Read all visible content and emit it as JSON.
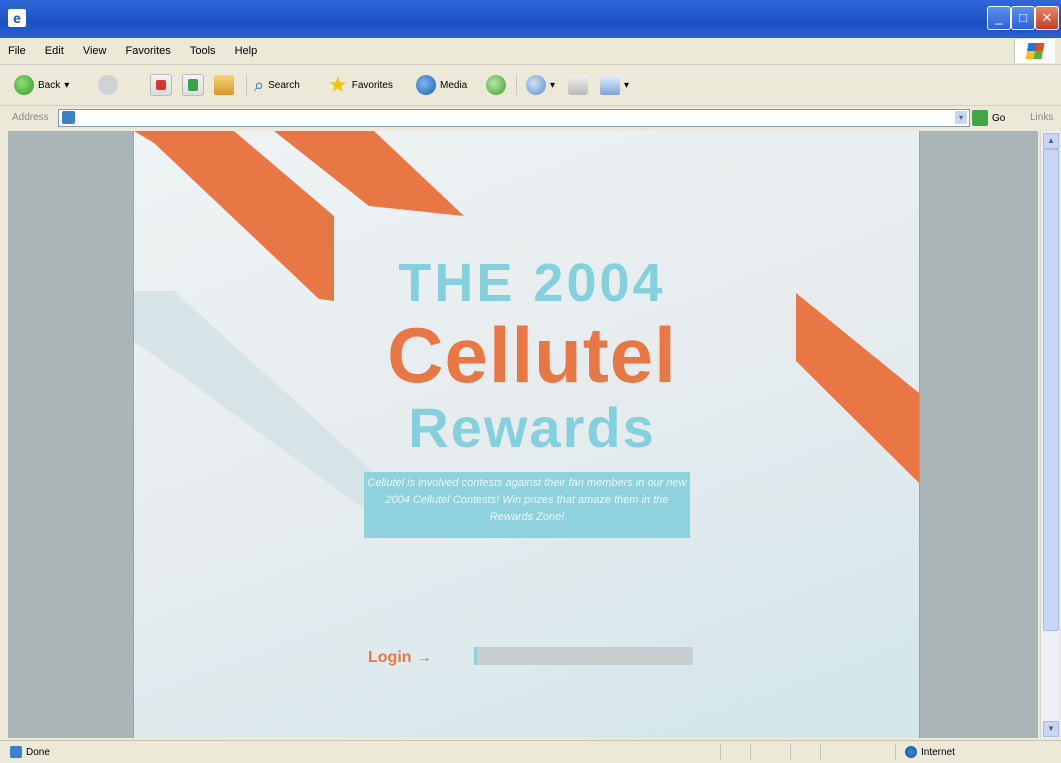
{
  "window": {
    "title_icon": "ie-icon"
  },
  "menu": [
    "File",
    "Edit",
    "View",
    "Favorites",
    "Tools",
    "Help"
  ],
  "toolbar": {
    "back_label": "Back",
    "search_label": "Search",
    "favorites_label": "Favorites",
    "media_label": "Media"
  },
  "address": {
    "label": "Address",
    "value": "",
    "go_label": "Go",
    "links_label": "Links"
  },
  "page": {
    "title_line1": "THE 2004",
    "title_line2": "Cellutel",
    "title_line3": "Rewards",
    "promo_text": "Cellutel is involved contests against their fan members in our new 2004 Cellutel Contests! Win prizes that amaze them in the Rewards Zone!",
    "login_label": "Login →",
    "colors": {
      "orange": "#e97745",
      "teal": "#86d0dd"
    }
  },
  "status": {
    "left": "Done",
    "right": "Internet"
  }
}
